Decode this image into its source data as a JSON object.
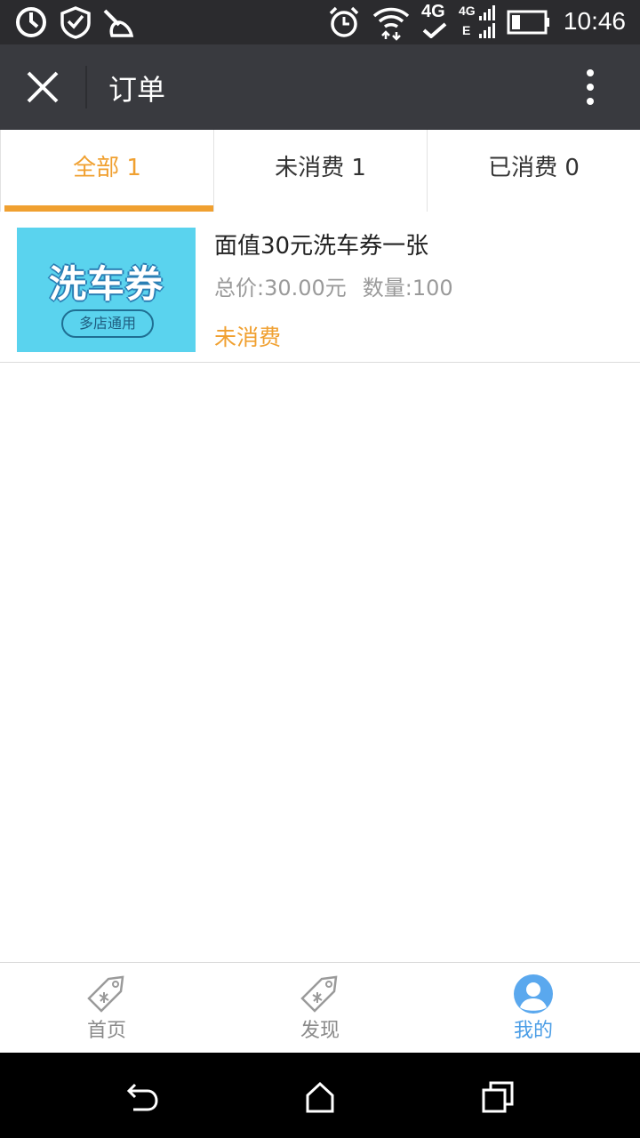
{
  "status_bar": {
    "time": "10:46",
    "network_label": "4G",
    "network_sub_label": "4G",
    "e_label": "E",
    "icons": [
      "sync-icon",
      "security-icon",
      "clean-icon",
      "alarm-icon",
      "wifi-icon",
      "4g-icon",
      "signal-icon",
      "battery-icon"
    ],
    "battery_level": 0.25
  },
  "header": {
    "title": "订单",
    "close_icon": "close-icon",
    "more_icon": "more-icon"
  },
  "tabs": [
    {
      "label": "全部 1",
      "active": true
    },
    {
      "label": "未消费 1",
      "active": false
    },
    {
      "label": "已消费 0",
      "active": false
    }
  ],
  "orders": [
    {
      "thumb_title": "洗车券",
      "thumb_subtitle": "多店通用",
      "name": "面值30元洗车券一张",
      "total": "总价:30.00元",
      "quantity": "数量:100",
      "status": "未消费"
    }
  ],
  "bottom_nav": [
    {
      "label": "首页",
      "icon": "tag-icon",
      "active": false
    },
    {
      "label": "发现",
      "icon": "tag-icon",
      "active": false
    },
    {
      "label": "我的",
      "icon": "user-icon",
      "active": true
    }
  ],
  "colors": {
    "accent": "#f0a030",
    "nav_active": "#4a9de6",
    "header_bg": "#393a3f",
    "thumb_bg": "#5ad3ee"
  }
}
